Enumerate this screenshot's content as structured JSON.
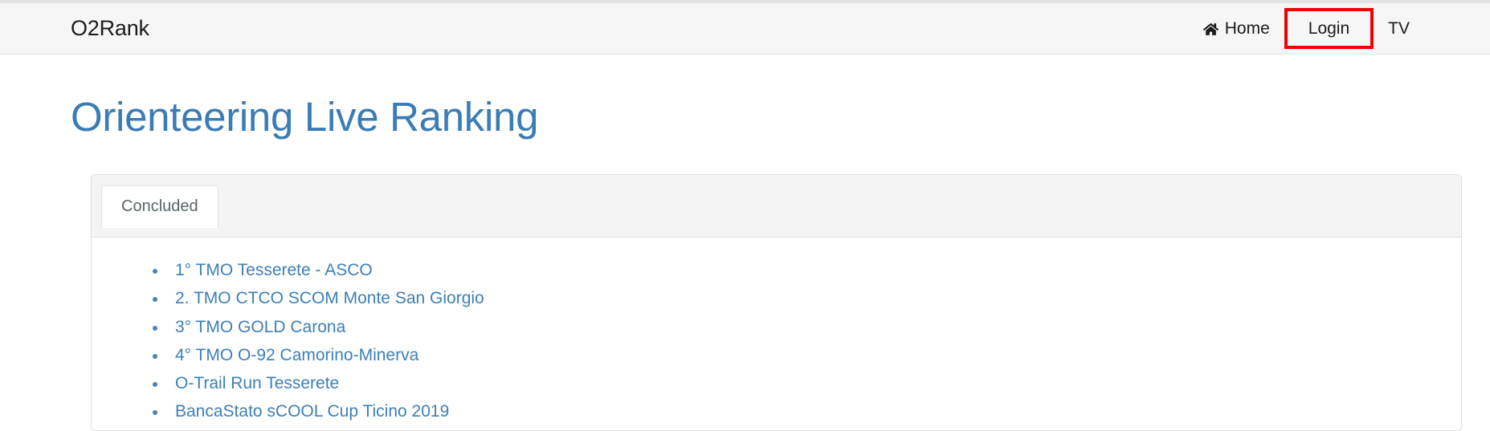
{
  "navbar": {
    "brand": "O2Rank",
    "links": [
      {
        "label": "Home",
        "icon": "home-icon",
        "highlighted": false
      },
      {
        "label": "Login",
        "icon": null,
        "highlighted": true
      },
      {
        "label": "TV",
        "icon": null,
        "highlighted": false
      }
    ],
    "highlight_color": "#f00000"
  },
  "page": {
    "title": "Orienteering Live Ranking",
    "title_color": "#3a7cb5"
  },
  "card": {
    "tabs": [
      {
        "label": "Concluded",
        "active": true
      }
    ],
    "events": [
      {
        "label": "1° TMO Tesserete - ASCO"
      },
      {
        "label": "2. TMO CTCO SCOM Monte San Giorgio"
      },
      {
        "label": "3° TMO GOLD Carona"
      },
      {
        "label": "4° TMO O-92 Camorino-Minerva"
      },
      {
        "label": "O-Trail Run Tesserete"
      },
      {
        "label": "BancaStato sCOOL Cup Ticino 2019"
      }
    ],
    "link_color": "#3c7fb8"
  }
}
